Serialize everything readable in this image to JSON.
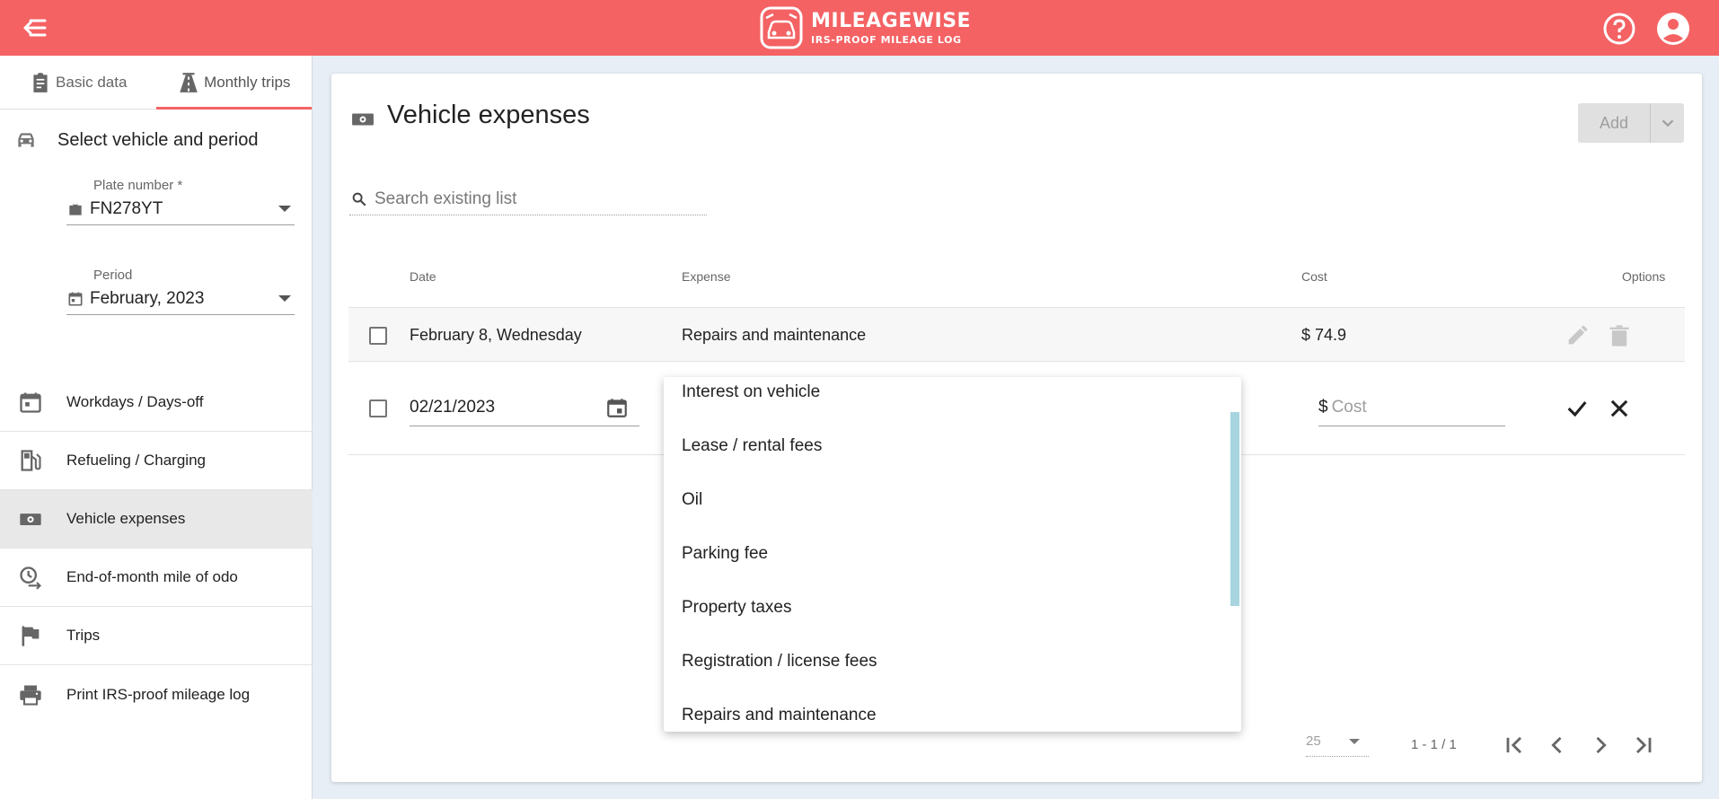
{
  "header": {
    "logo_title": "MILEAGEWISE",
    "logo_subtitle": "IRS-PROOF MILEAGE LOG",
    "colors": {
      "brand": "#f46264"
    }
  },
  "sidebar": {
    "tabs": [
      {
        "label": "Basic data",
        "icon": "clipboard-icon",
        "active": false
      },
      {
        "label": "Monthly trips",
        "icon": "road-icon",
        "active": true
      }
    ],
    "section_title": "Select vehicle and period",
    "plate": {
      "label": "Plate number *",
      "value": "FN278YT"
    },
    "period": {
      "label": "Period",
      "value": "February, 2023"
    },
    "items": [
      {
        "label": "Workdays / Days-off",
        "icon": "calendar-icon",
        "active": false
      },
      {
        "label": "Refueling / Charging",
        "icon": "fuel-pump-icon",
        "active": false
      },
      {
        "label": "Vehicle expenses",
        "icon": "money-icon",
        "active": true
      },
      {
        "label": "End-of-month mile of odo",
        "icon": "odometer-icon",
        "active": false
      },
      {
        "label": "Trips",
        "icon": "flag-icon",
        "active": false
      },
      {
        "label": "Print IRS-proof mileage log",
        "icon": "printer-icon",
        "active": false
      }
    ]
  },
  "main": {
    "title": "Vehicle expenses",
    "add_label": "Add",
    "search_placeholder": "Search existing list",
    "columns": {
      "date": "Date",
      "expense": "Expense",
      "cost": "Cost",
      "options": "Options"
    },
    "rows": [
      {
        "date": "February 8, Wednesday",
        "expense": "Repairs and maintenance",
        "cost": "$ 74.9"
      }
    ],
    "edit_row": {
      "date": "02/21/2023",
      "currency": "$",
      "cost_placeholder": "Cost"
    },
    "dropdown_options": [
      "Interest on vehicle",
      "Lease / rental fees",
      "Oil",
      "Parking fee",
      "Property taxes",
      "Registration / license fees",
      "Repairs and maintenance"
    ],
    "pagination": {
      "per_page": "25",
      "range": "1 - 1 / 1"
    }
  }
}
